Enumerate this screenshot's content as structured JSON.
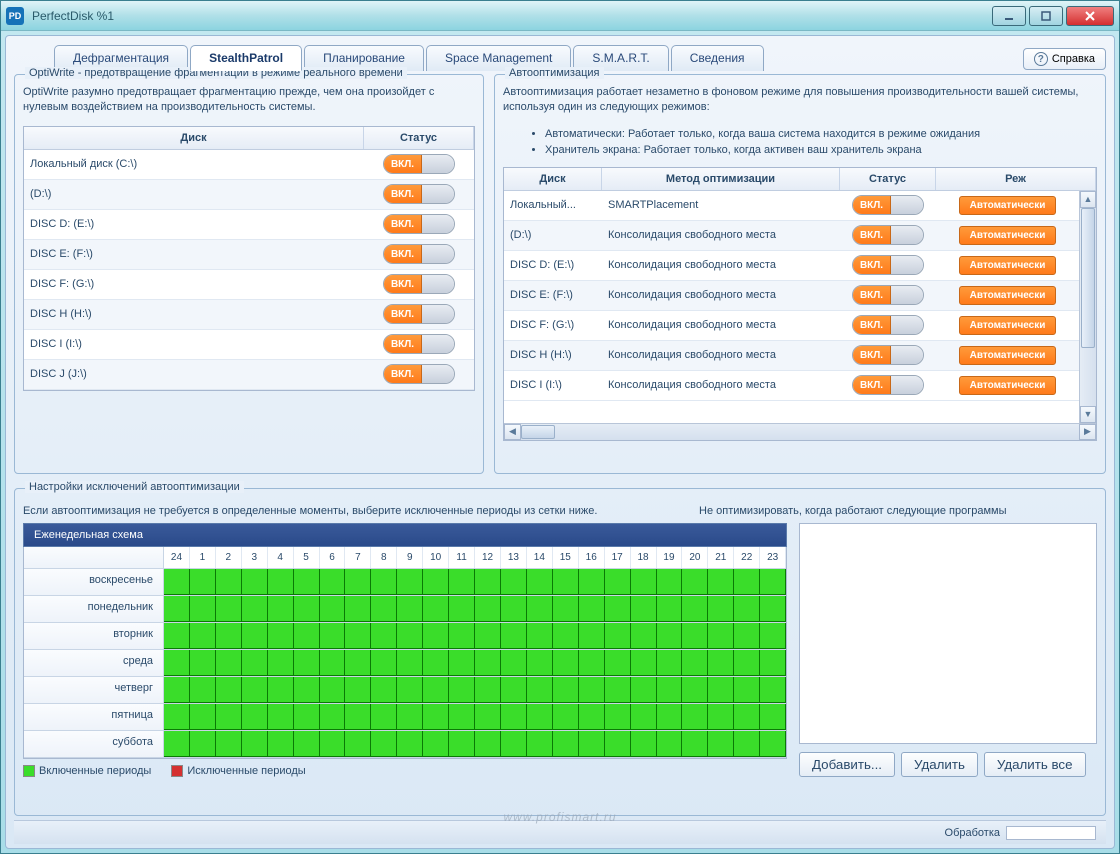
{
  "window": {
    "title": "PerfectDisk %1",
    "icon_text": "PD"
  },
  "win_controls": {
    "minimize": "minimize",
    "maximize": "maximize",
    "close": "close"
  },
  "tabs": [
    {
      "label": "Дефрагментация",
      "active": false
    },
    {
      "label": "StealthPatrol",
      "active": true
    },
    {
      "label": "Планирование",
      "active": false
    },
    {
      "label": "Space Management",
      "active": false
    },
    {
      "label": "S.M.A.R.T.",
      "active": false
    },
    {
      "label": "Сведения",
      "active": false
    }
  ],
  "help": {
    "label": "Справка",
    "icon": "?"
  },
  "optiwrite": {
    "title": "OptiWrite - предотвращение фрагментации в режиме реального времени",
    "description": "OptiWrite разумно предотвращает фрагментацию прежде, чем она произойдет с нулевым воздействием на производительность системы.",
    "columns": {
      "disk": "Диск",
      "status": "Статус"
    },
    "rows": [
      {
        "disk": "Локальный диск (C:\\)",
        "status": "ВКЛ."
      },
      {
        "disk": "(D:\\)",
        "status": "ВКЛ."
      },
      {
        "disk": "DISC D: (E:\\)",
        "status": "ВКЛ."
      },
      {
        "disk": "DISC E: (F:\\)",
        "status": "ВКЛ."
      },
      {
        "disk": "DISC F: (G:\\)",
        "status": "ВКЛ."
      },
      {
        "disk": "DISC H (H:\\)",
        "status": "ВКЛ."
      },
      {
        "disk": "DISC I (I:\\)",
        "status": "ВКЛ."
      },
      {
        "disk": "DISC J (J:\\)",
        "status": "ВКЛ."
      }
    ]
  },
  "autoopt": {
    "title": "Автооптимизация",
    "description": "Автооптимизация работает незаметно в фоновом режиме для повышения производительности вашей системы, используя один из следующих режимов:",
    "bullets": [
      "Автоматически: Работает только, когда ваша система находится в режиме ожидания",
      "Хранитель экрана: Работает только, когда активен ваш хранитель экрана"
    ],
    "columns": {
      "disk": "Диск",
      "method": "Метод оптимизации",
      "status": "Статус",
      "mode": "Реж"
    },
    "rows": [
      {
        "disk": "Локальный...",
        "method": "SMARTPlacement",
        "status": "ВКЛ.",
        "mode": "Автоматически"
      },
      {
        "disk": "(D:\\)",
        "method": "Консолидация свободного места",
        "status": "ВКЛ.",
        "mode": "Автоматически"
      },
      {
        "disk": "DISC D: (E:\\)",
        "method": "Консолидация свободного места",
        "status": "ВКЛ.",
        "mode": "Автоматически"
      },
      {
        "disk": "DISC E: (F:\\)",
        "method": "Консолидация свободного места",
        "status": "ВКЛ.",
        "mode": "Автоматически"
      },
      {
        "disk": "DISC F: (G:\\)",
        "method": "Консолидация свободного места",
        "status": "ВКЛ.",
        "mode": "Автоматически"
      },
      {
        "disk": "DISC H (H:\\)",
        "method": "Консолидация свободного места",
        "status": "ВКЛ.",
        "mode": "Автоматически"
      },
      {
        "disk": "DISC I (I:\\)",
        "method": "Консолидация свободного места",
        "status": "ВКЛ.",
        "mode": "Автоматически"
      }
    ]
  },
  "exclusions": {
    "title": "Настройки исключений автооптимизации",
    "description_left": "Если автооптимизация не требуется в определенные моменты, выберите исключенные периоды из сетки ниже.",
    "description_right": "Не оптимизировать, когда работают следующие программы",
    "schedule_header": "Еженедельная схема",
    "hours": [
      "24",
      "1",
      "2",
      "3",
      "4",
      "5",
      "6",
      "7",
      "8",
      "9",
      "10",
      "11",
      "12",
      "13",
      "14",
      "15",
      "16",
      "17",
      "18",
      "19",
      "20",
      "21",
      "22",
      "23"
    ],
    "days": [
      "воскресенье",
      "понедельник",
      "вторник",
      "среда",
      "четверг",
      "пятница",
      "суббота"
    ],
    "legend": {
      "included": {
        "label": "Включенные периоды",
        "color": "#3add2a"
      },
      "excluded": {
        "label": "Исключенные периоды",
        "color": "#d43030"
      }
    },
    "buttons": {
      "add": "Добавить...",
      "delete": "Удалить",
      "delete_all": "Удалить все"
    }
  },
  "statusbar": {
    "label": "Обработка"
  },
  "watermark": "www.profismart.ru"
}
